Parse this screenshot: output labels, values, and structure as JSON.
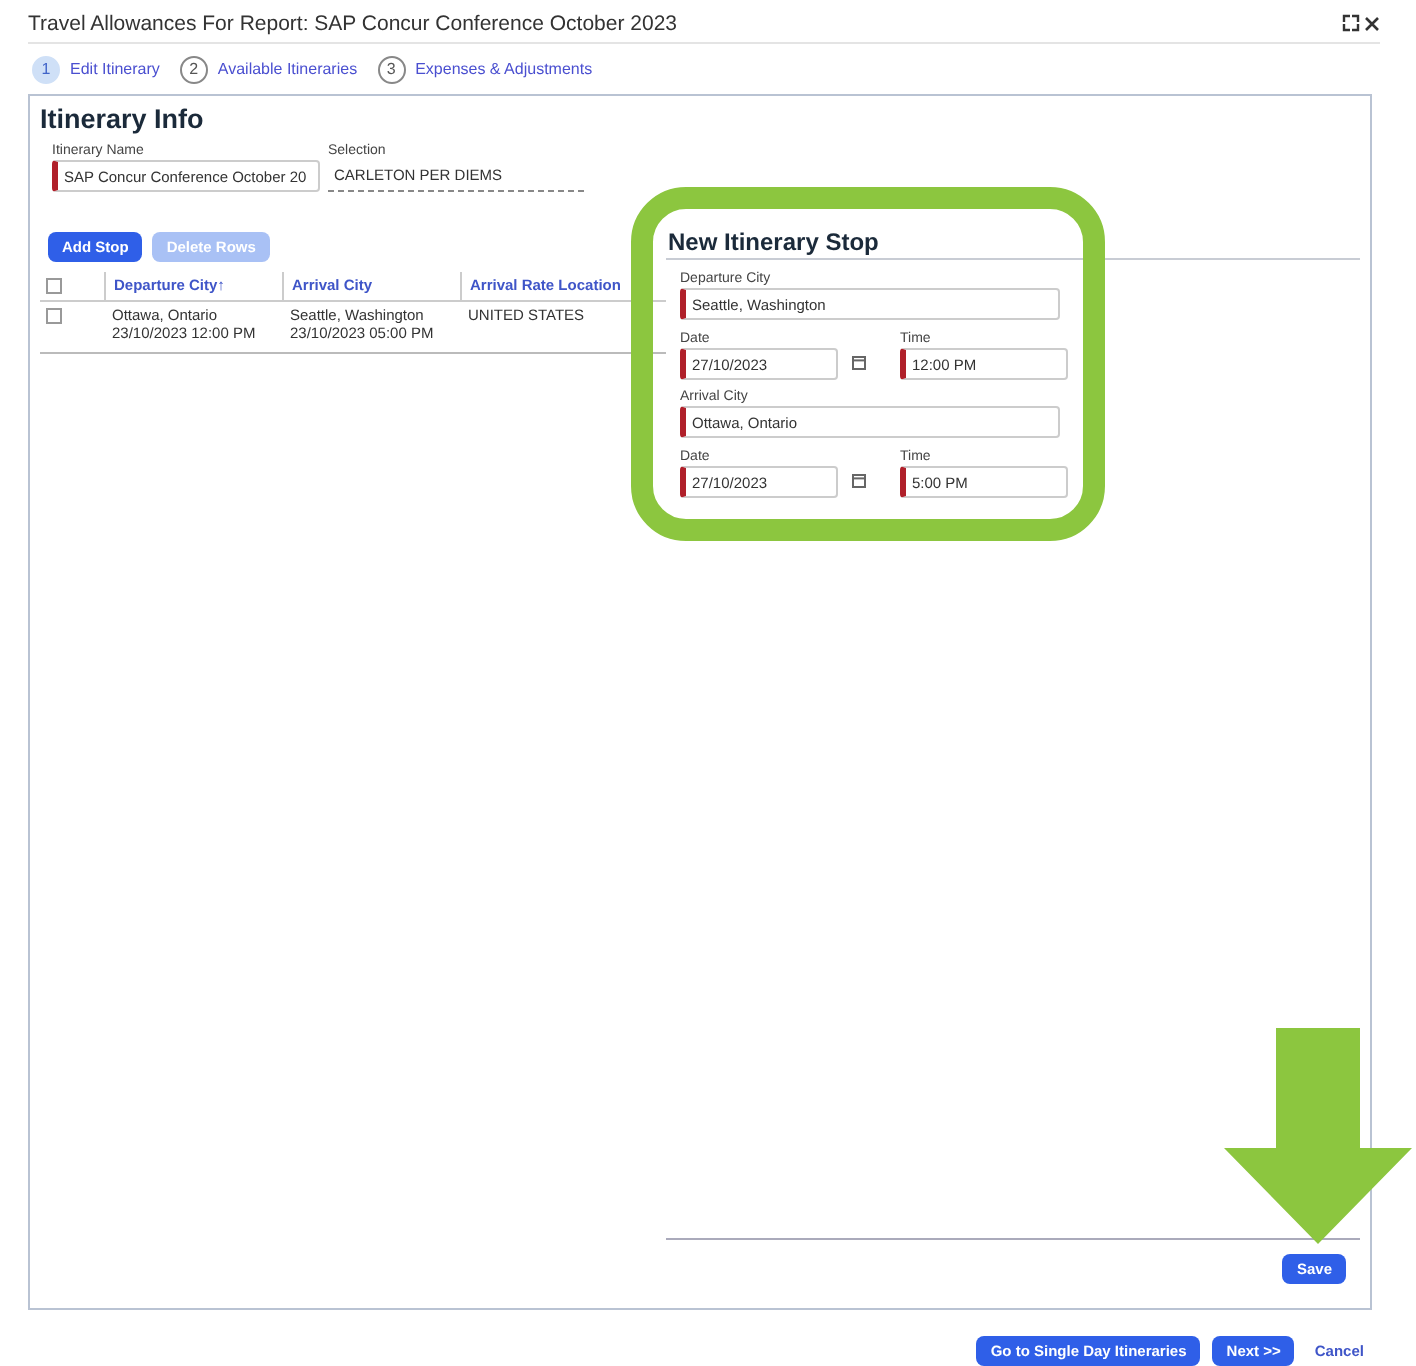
{
  "window": {
    "title": "Travel Allowances For Report: SAP Concur Conference October 2023"
  },
  "steps": [
    {
      "number": "1",
      "label": "Edit Itinerary",
      "selected": true
    },
    {
      "number": "2",
      "label": "Available Itineraries",
      "selected": false
    },
    {
      "number": "3",
      "label": "Expenses & Adjustments",
      "selected": false
    }
  ],
  "itinerary_info": {
    "heading": "Itinerary Info",
    "name_label": "Itinerary Name",
    "name_value": "SAP Concur Conference October 20",
    "selection_label": "Selection",
    "selection_value": "CARLETON PER DIEMS"
  },
  "table_buttons": [
    {
      "label": "Add Stop",
      "disabled": false
    },
    {
      "label": "Delete Rows",
      "disabled": true
    }
  ],
  "table": {
    "select_all_checked": false,
    "columns": [
      "Departure City↑",
      "Arrival City",
      "Arrival Rate Location"
    ],
    "rows": [
      {
        "checked": false,
        "cells": [
          [
            "Ottawa, Ontario",
            "23/10/2023 12:00 PM"
          ],
          [
            "Seattle, Washington",
            "23/10/2023 05:00 PM"
          ],
          [
            "UNITED STATES"
          ]
        ]
      }
    ]
  },
  "new_stop": {
    "heading": "New Itinerary Stop",
    "groups": [
      {
        "city_label": "Departure City",
        "city": "Seattle, Washington",
        "date_label": "Date",
        "date": "27/10/2023",
        "time_label": "Time",
        "time": "12:00 PM"
      },
      {
        "city_label": "Arrival City",
        "city": "Ottawa, Ontario",
        "date_label": "Date",
        "date": "27/10/2023",
        "time_label": "Time",
        "time": "5:00 PM"
      }
    ],
    "save": "Save"
  },
  "footer_buttons": [
    {
      "label": "Go to Single Day Itineraries",
      "kind": "button"
    },
    {
      "label": "Next >>",
      "kind": "button"
    },
    {
      "label": "Cancel",
      "kind": "link"
    }
  ]
}
